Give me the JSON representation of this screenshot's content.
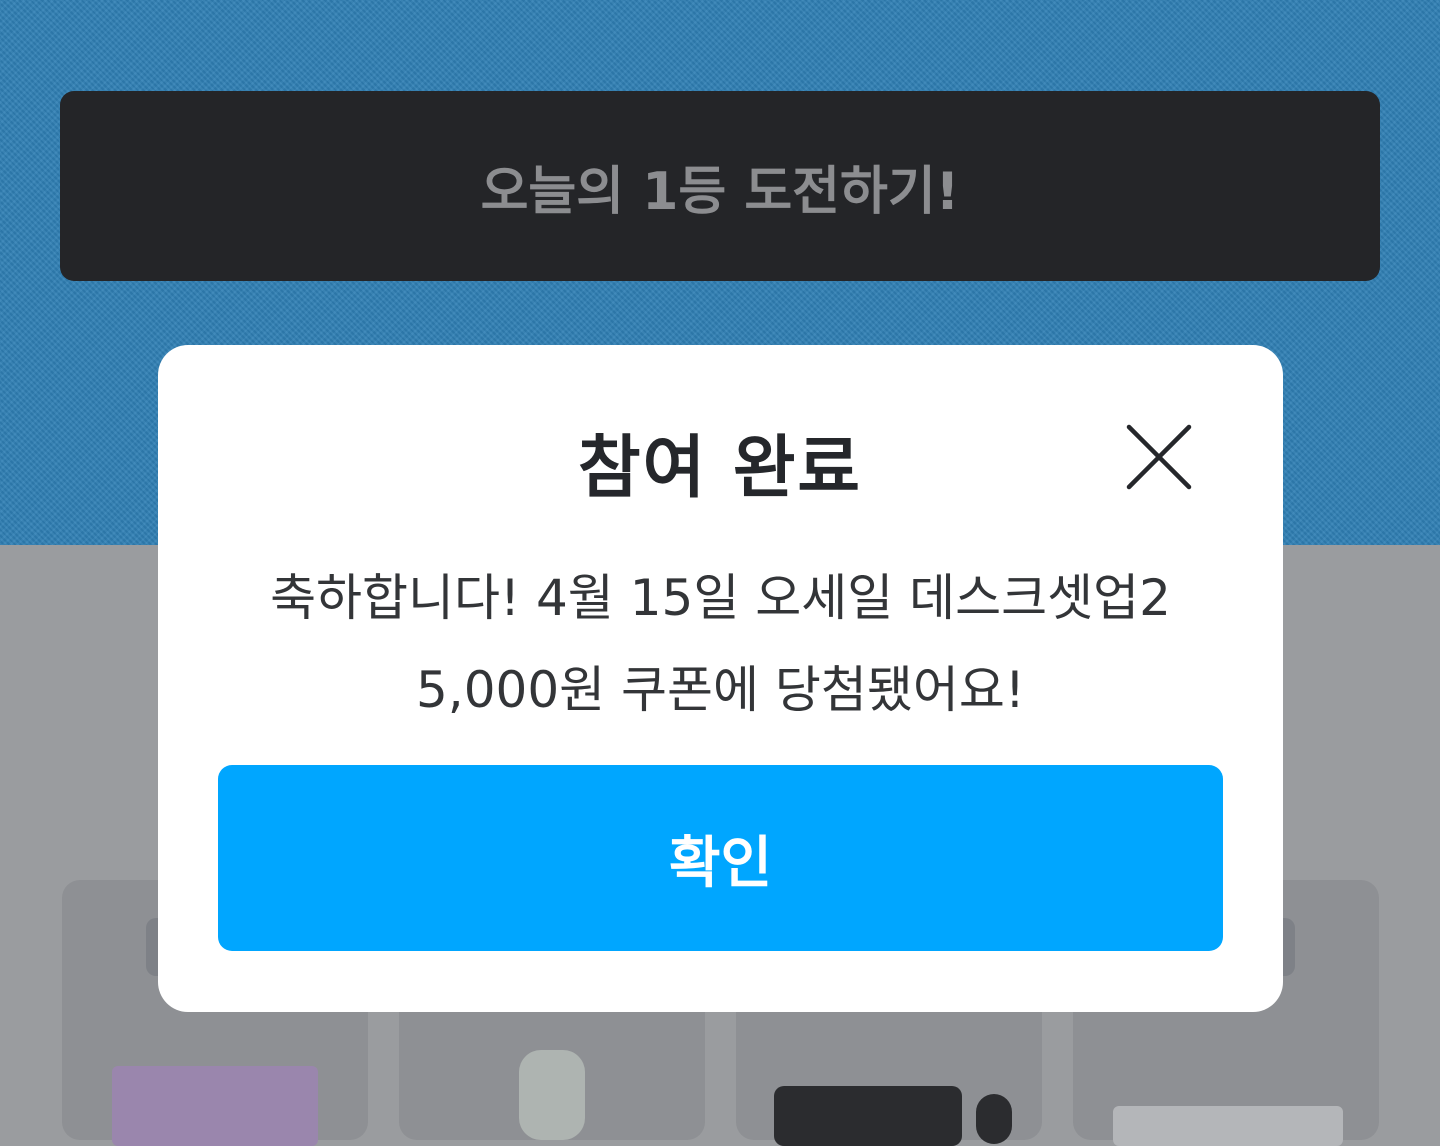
{
  "page": {
    "challenge_button_label": "오늘의 1등 도전하기!"
  },
  "background_cards": [
    {
      "label": "",
      "product": "purple-mousepad"
    },
    {
      "label": "",
      "product": "gray-speaker"
    },
    {
      "label": "",
      "product": "black-keyboard"
    },
    {
      "label": "",
      "product": "white-keyboard"
    }
  ],
  "modal": {
    "title": "참여 완료",
    "message_line1": "축하합니다! 4월 15일 오세일 데스크셋업2",
    "message_line2": "5,000원 쿠폰에 당첨됐어요!",
    "confirm_label": "확인",
    "close_icon": "close-icon"
  },
  "colors": {
    "primary": "#00a6ff",
    "dark_button": "#242528",
    "background_blue": "#2f7fb4"
  }
}
